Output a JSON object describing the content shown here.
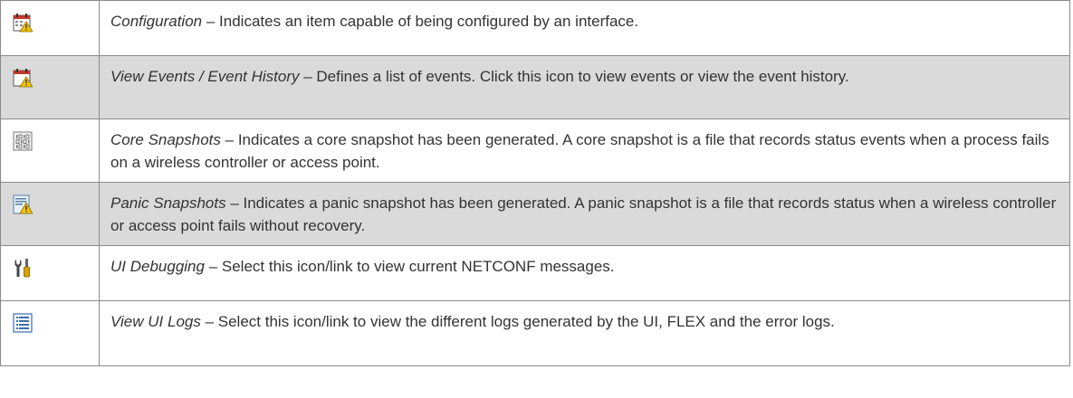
{
  "rows": [
    {
      "icon": "calendar-warning-icon",
      "term": "Configuration",
      "sep": " – ",
      "desc": "Indicates an item capable of being configured by an interface.",
      "shaded": false
    },
    {
      "icon": "calendar-events-warning-icon",
      "term": "View Events / Event History",
      "sep": " – ",
      "desc": "Defines a list of events. Click this icon to view events or view the event history.",
      "shaded": true
    },
    {
      "icon": "binary-snapshot-icon",
      "term": "Core Snapshots",
      "sep": " – ",
      "desc": "Indicates a core snapshot has been generated. A core snapshot is a file that records status events when a process fails on a wireless controller or access point.",
      "shaded": false
    },
    {
      "icon": "document-warning-icon",
      "term": "Panic Snapshots",
      "sep": " – ",
      "desc": "Indicates a panic snapshot has been generated. A panic snapshot is a file that records status when a wireless controller or access point fails without recovery.",
      "shaded": true
    },
    {
      "icon": "wrench-screwdriver-icon",
      "term": "UI Debugging",
      "sep": " – ",
      "desc": "Select this icon/link to view current NETCONF messages.",
      "shaded": false
    },
    {
      "icon": "log-list-icon",
      "term": "View UI Logs",
      "sep": " – ",
      "desc": "Select this icon/link to view the different logs generated by the UI, FLEX and the error logs.",
      "shaded": false
    }
  ],
  "colors": {
    "shade": "#dadada",
    "border": "#8a8a8a",
    "text": "#333333",
    "warning": "#f5c400"
  }
}
